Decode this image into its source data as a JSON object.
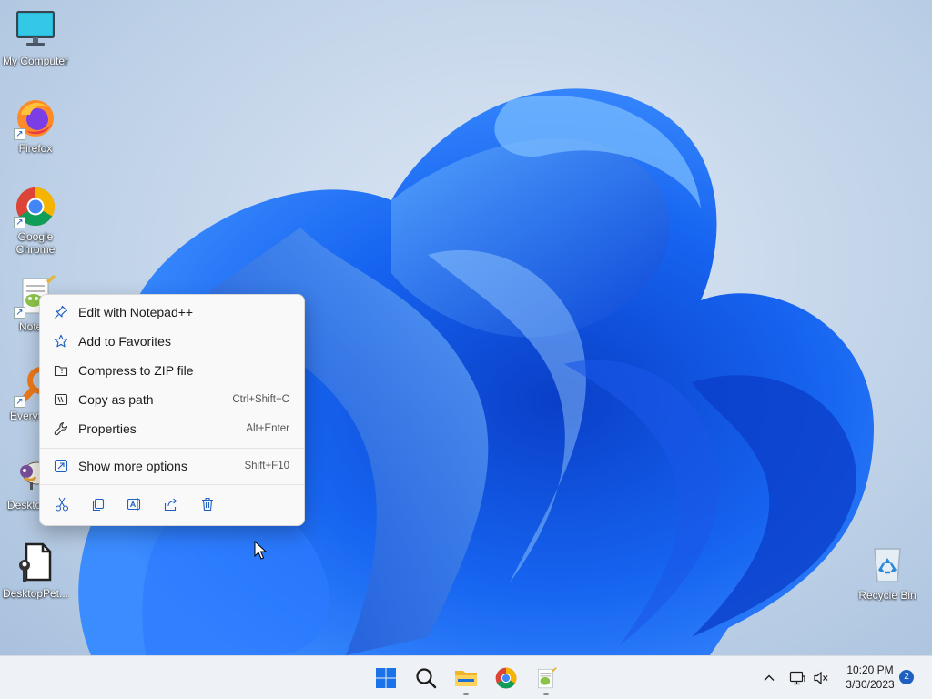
{
  "desktop": {
    "icons": [
      {
        "label": "My Computer",
        "icon": "monitor-icon"
      },
      {
        "label": "Firefox",
        "icon": "firefox-icon"
      },
      {
        "label": "Google Chrome",
        "icon": "chrome-icon"
      },
      {
        "label": "Notepad++",
        "visible_label": "Notep",
        "icon": "notepadpp-icon"
      },
      {
        "label": "Everything",
        "visible_label": "Everyt",
        "icon": "everything-search-icon"
      },
      {
        "label": "DesktopPet",
        "visible_label": "Deskto",
        "icon": "sheep-icon"
      },
      {
        "label": "DesktopPet...",
        "icon": "file-wrench-icon"
      },
      {
        "label": "Recycle Bin",
        "icon": "recycle-bin-icon"
      }
    ]
  },
  "context_menu": {
    "items": [
      {
        "label": "Edit with Notepad++",
        "shortcut": "",
        "icon": "pin-icon"
      },
      {
        "label": "Add to Favorites",
        "shortcut": "",
        "icon": "star-icon"
      },
      {
        "label": "Compress to ZIP file",
        "shortcut": "",
        "icon": "zip-folder-icon"
      },
      {
        "label": "Copy as path",
        "shortcut": "Ctrl+Shift+C",
        "icon": "copy-path-icon"
      },
      {
        "label": "Properties",
        "shortcut": "Alt+Enter",
        "icon": "wrench-icon"
      }
    ],
    "more_options": {
      "label": "Show more options",
      "shortcut": "Shift+F10",
      "icon": "show-more-icon"
    },
    "quick_actions": [
      "cut-icon",
      "copy-icon",
      "rename-icon",
      "share-icon",
      "delete-icon"
    ]
  },
  "taskbar": {
    "apps": [
      "start-icon",
      "search-icon",
      "file-explorer-icon",
      "chrome-icon",
      "notepadpp-icon"
    ],
    "tray": {
      "chevron": "chevron-up-icon",
      "network": "network-icon",
      "volume": "volume-muted-icon"
    },
    "clock": {
      "time": "10:20 PM",
      "date": "3/30/2023"
    },
    "notifications": "2"
  },
  "colors": {
    "accent": "#1f5fbf",
    "wallpaper_bloom": "#1e64f0"
  }
}
